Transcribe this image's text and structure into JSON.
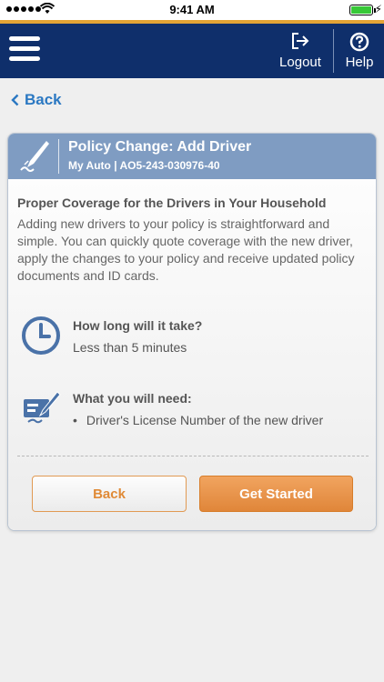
{
  "status_bar": {
    "time": "9:41 AM"
  },
  "app_bar": {
    "logout_label": "Logout",
    "help_label": "Help",
    "icons": {
      "menu": "hamburger-icon",
      "logout": "logout-icon",
      "help": "help-icon"
    },
    "colors": {
      "bar": "#0f2f6b",
      "stripe": "#e3a436"
    }
  },
  "nav": {
    "back_label": "Back"
  },
  "card": {
    "title": "Policy Change: Add Driver",
    "subtitle": "My Auto | AO5-243-030976-40",
    "section_title": "Proper Coverage for the Drivers in Your Household",
    "intro": "Adding new drivers to your policy is straightforward and simple. You can quickly quote coverage with the new driver, apply the changes to your policy and receive updated policy documents and ID cards.",
    "duration": {
      "title": "How long will it take?",
      "value": "Less than 5 minutes"
    },
    "requirements": {
      "title": "What you will need:",
      "items": [
        "Driver's License Number of the new driver"
      ]
    },
    "buttons": {
      "back": "Back",
      "start": "Get Started"
    },
    "colors": {
      "header": "#7f9cc2",
      "accent": "#e0863a",
      "icon": "#4a72a8",
      "link": "#2b78c2"
    }
  }
}
